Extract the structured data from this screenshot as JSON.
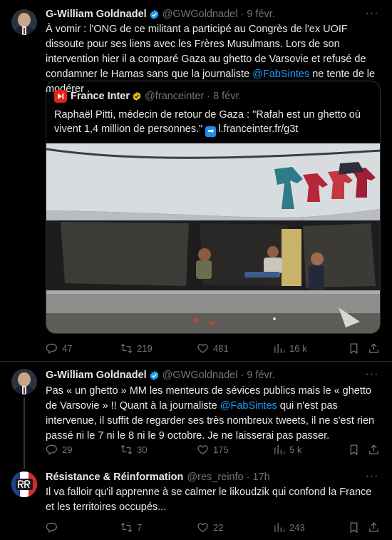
{
  "tweets": [
    {
      "name": "G-William Goldnadel",
      "handle": "@GWGoldnadel",
      "date": "9 févr.",
      "text_part1": "À vomir  : l'ONG de ce militant a participé au Congrès de l'ex UOIF dissoute pour ses liens avec les Frères Musulmans. Lors de son intervention hier il a comparé Gaza au ghetto de Varsovie et refusé de condamner le Hamas sans que la journaliste ",
      "mention": "@FabSintes",
      "text_part2": " ne tente de le modérer .",
      "quote": {
        "name": "France Inter",
        "handle": "@franceinter",
        "date": "8 févr.",
        "text": "Raphaël Pitti, médecin de retour de Gaza : \"Rafah est un ghetto où vivent 1,4 million de personnes.\"",
        "link": "l.franceinter.fr/g3t"
      },
      "stats": {
        "replies": "47",
        "retweets": "219",
        "likes": "481",
        "views": "16 k"
      }
    },
    {
      "name": "G-William Goldnadel",
      "handle": "@GWGoldnadel",
      "date": "9 févr.",
      "text_part1": "Pas « un ghetto » MM les menteurs de sévices publics mais le « ghetto de Varsovie » !! Quant à la journaliste ",
      "mention": "@FabSintes",
      "text_part2": " qui n'est pas intervenue, il suffit de regarder ses très nombreux tweets, il ne s'est rien passé ni le 7 ni le 8 ni le 9 octobre. Je ne laisserai pas passer.",
      "stats": {
        "replies": "29",
        "retweets": "30",
        "likes": "175",
        "views": "5 k"
      }
    },
    {
      "name": "Résistance & Réinformation",
      "handle": "@res_reinfo",
      "date": "17h",
      "text": "Il va falloir qu'il apprenne à se calmer le likoudzik qui confond la France et les territoires occupés...",
      "stats": {
        "replies": "",
        "retweets": "7",
        "likes": "22",
        "views": "243"
      }
    }
  ],
  "colors": {
    "accent": "#1d9bf0",
    "muted": "#71767b",
    "gold_badge": "#e2b719",
    "brand_red": "#e2231a"
  }
}
